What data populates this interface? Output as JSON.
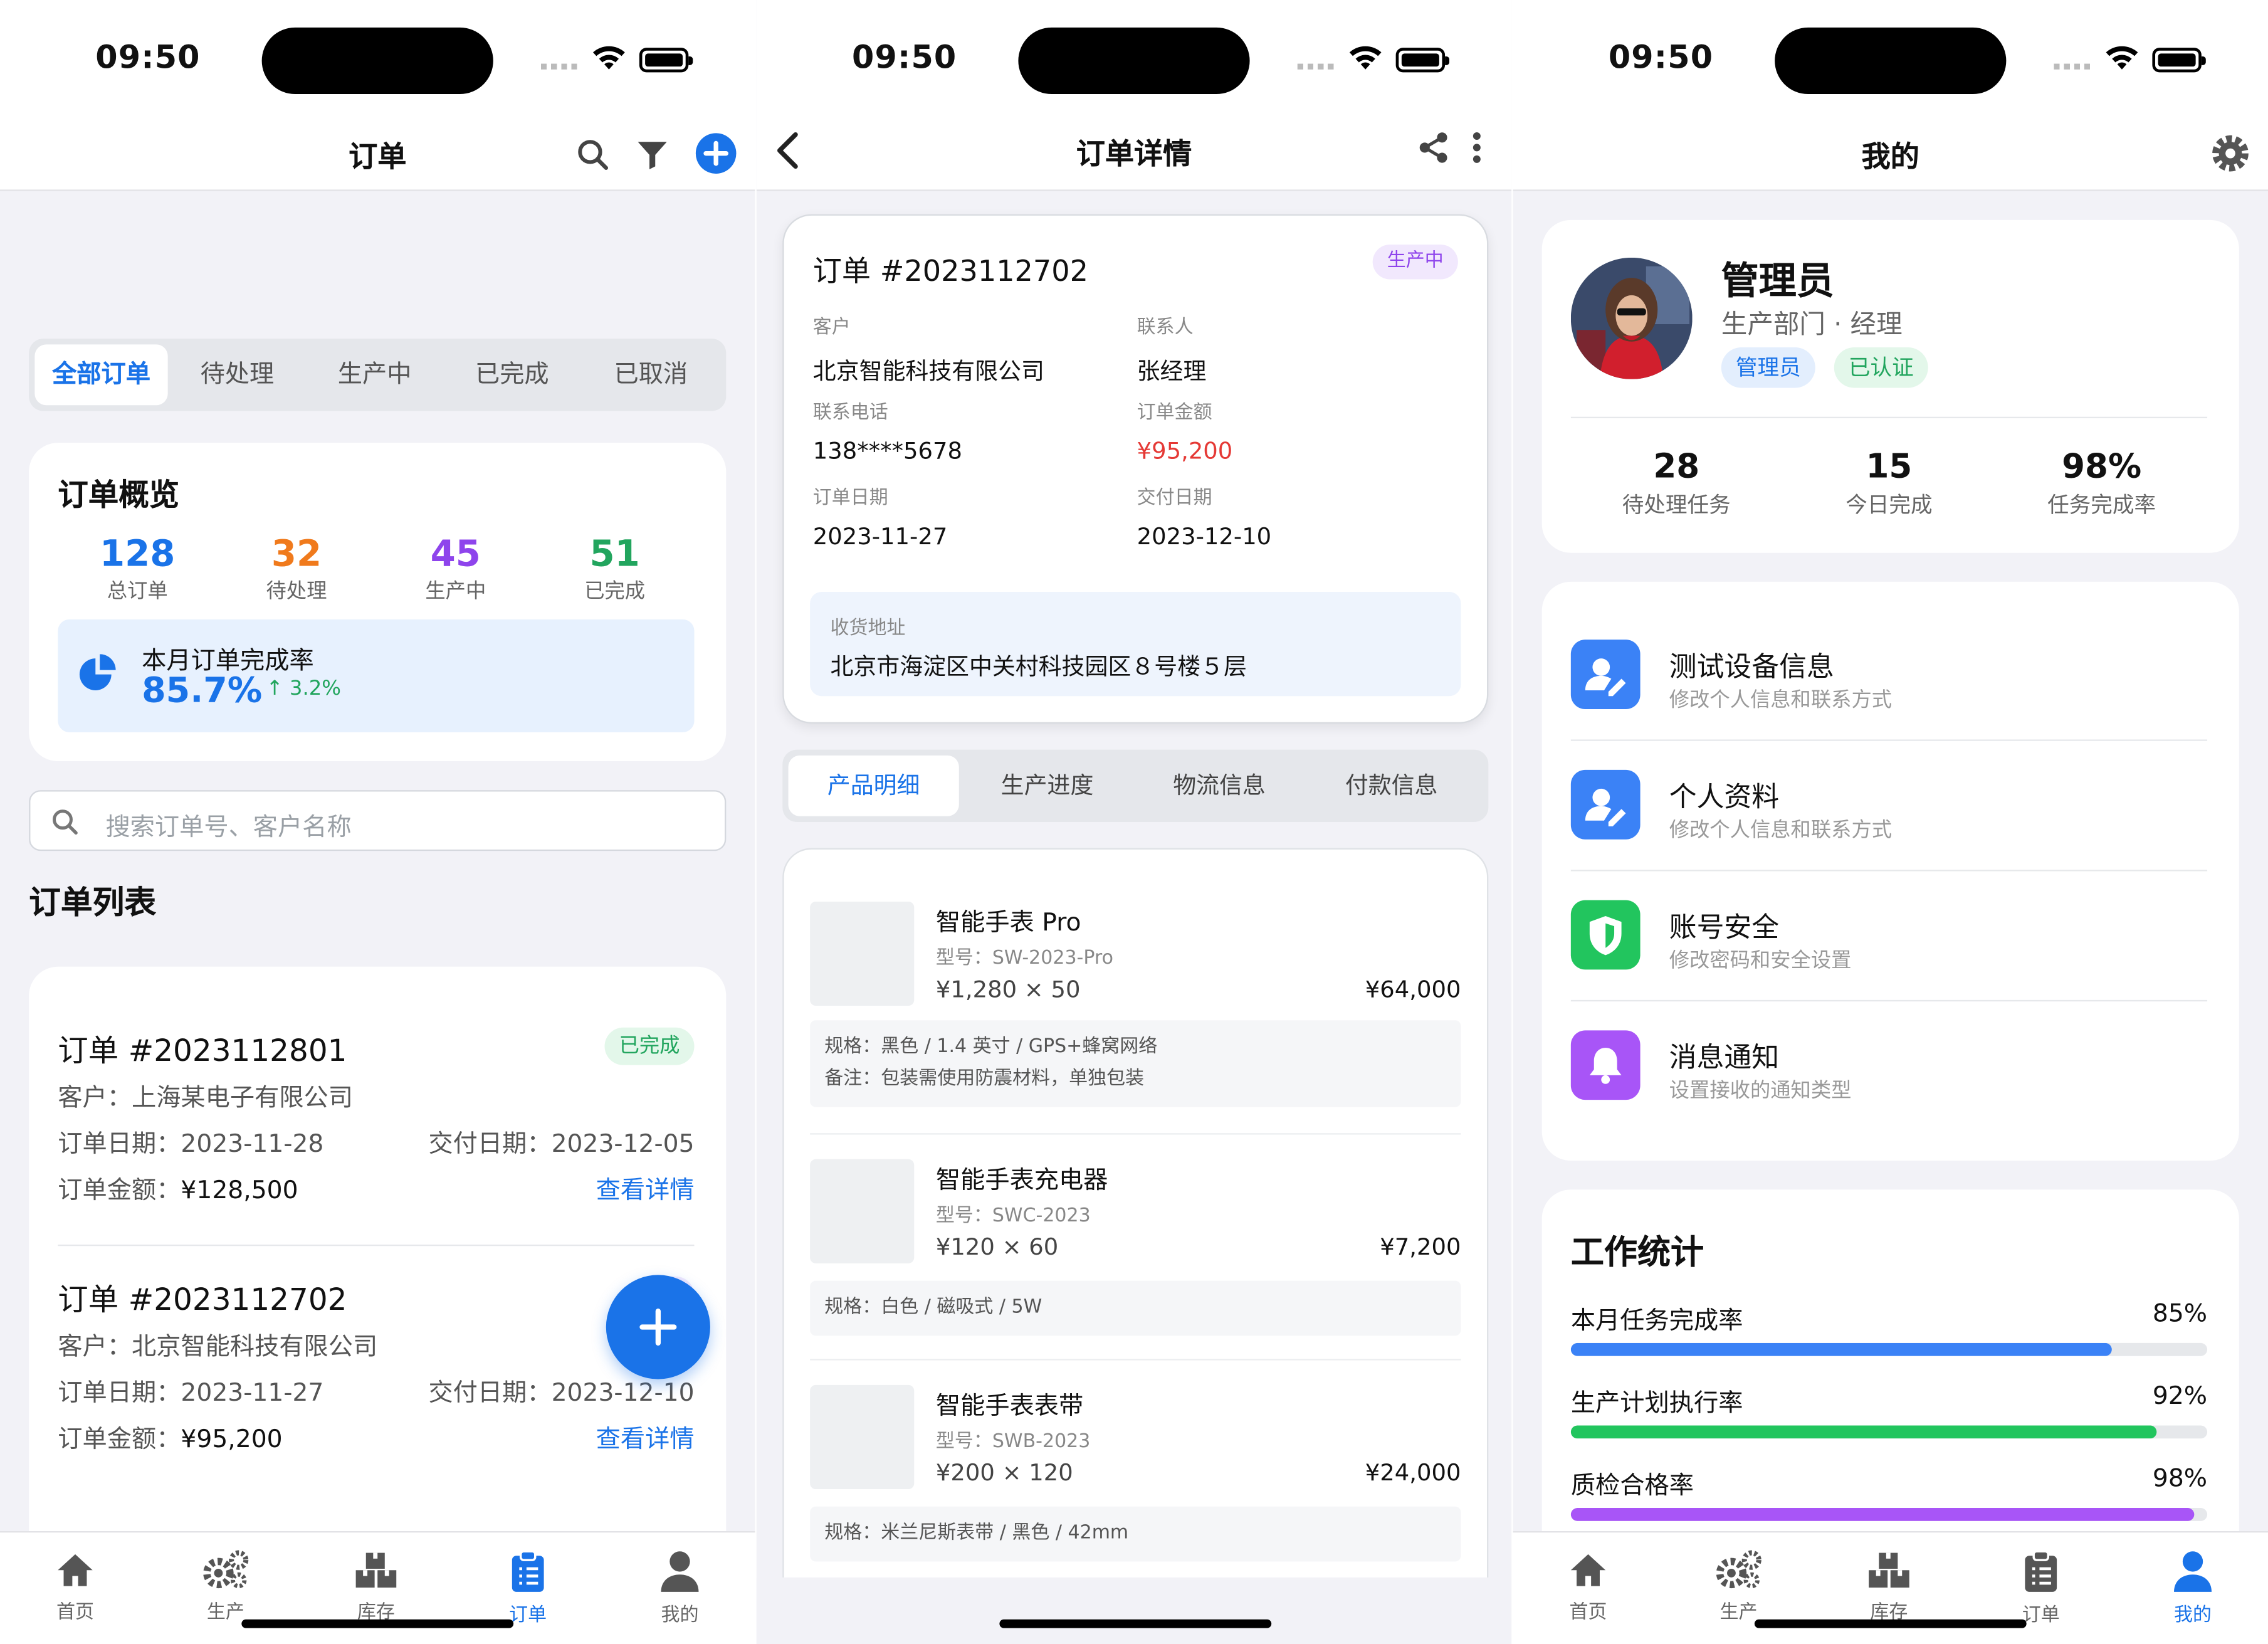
{
  "status": {
    "time": "09:50"
  },
  "screen1": {
    "title": "订单",
    "filters": [
      "全部订单",
      "待处理",
      "生产中",
      "已完成",
      "已取消"
    ],
    "overview": {
      "title": "订单概览",
      "stats": [
        {
          "value": "128",
          "label": "总订单",
          "color": "#1a73e8"
        },
        {
          "value": "32",
          "label": "待处理",
          "color": "#f07a1c"
        },
        {
          "value": "45",
          "label": "生产中",
          "color": "#8e44ec"
        },
        {
          "value": "51",
          "label": "已完成",
          "color": "#22a55e"
        }
      ],
      "rate_label": "本月订单完成率",
      "rate_value": "85.7%",
      "rate_delta": "3.2%"
    },
    "search_placeholder": "搜索订单号、客户名称",
    "list_title": "订单列表",
    "orders": [
      {
        "no": "订单 #2023112801",
        "status": "已完成",
        "customer": "客户：上海某电子有限公司",
        "order_date": "订单日期：2023-11-28",
        "delivery_date": "交付日期：2023-12-05",
        "amount_label": "订单金额：",
        "amount": "¥128,500",
        "link": "查看详情"
      },
      {
        "no": "订单 #2023112702",
        "status": "",
        "customer": "客户：北京智能科技有限公司",
        "order_date": "订单日期：2023-11-27",
        "delivery_date": "交付日期：2023-12-10",
        "amount_label": "订单金额：",
        "amount": "¥95,200",
        "link": "查看详情"
      }
    ]
  },
  "screen2": {
    "title": "订单详情",
    "order_no": "订单 #2023112702",
    "status": "生产中",
    "fields": [
      {
        "label": "客户",
        "value": "北京智能科技有限公司"
      },
      {
        "label": "联系人",
        "value": "张经理"
      },
      {
        "label": "联系电话",
        "value": "138****5678"
      },
      {
        "label": "订单金额",
        "value": "¥95,200"
      },
      {
        "label": "订单日期",
        "value": "2023-11-27"
      },
      {
        "label": "交付日期",
        "value": "2023-12-10"
      }
    ],
    "address_label": "收货地址",
    "address": "北京市海淀区中关村科技园区８号楼５层",
    "tabs": [
      "产品明细",
      "生产进度",
      "物流信息",
      "付款信息"
    ],
    "products": [
      {
        "name": "智能手表 Pro",
        "model": "型号：SW-2023-Pro",
        "qty": "¥1,280 × 50",
        "total": "¥64,000",
        "spec": "规格：黑色 / 1.4 英寸 / GPS+蜂窝网络",
        "note": "备注：包装需使用防震材料，单独包装"
      },
      {
        "name": "智能手表充电器",
        "model": "型号：SWC-2023",
        "qty": "¥120 × 60",
        "total": "¥7,200",
        "spec": "规格：白色 / 磁吸式 / 5W",
        "note": ""
      },
      {
        "name": "智能手表表带",
        "model": "型号：SWB-2023",
        "qty": "¥200 × 120",
        "total": "¥24,000",
        "spec": "规格：米兰尼斯表带 / 黑色 / 42mm",
        "note": ""
      }
    ]
  },
  "screen3": {
    "title": "我的",
    "name": "管理员",
    "dept": "生产部门 · 经理",
    "chips": [
      "管理员",
      "已认证"
    ],
    "stats": [
      {
        "value": "28",
        "label": "待处理任务"
      },
      {
        "value": "15",
        "label": "今日完成"
      },
      {
        "value": "98%",
        "label": "任务完成率"
      }
    ],
    "menu": [
      {
        "title": "测试设备信息",
        "sub": "修改个人信息和联系方式",
        "color": "#3b82f6",
        "icon": "user-edit-icon"
      },
      {
        "title": "个人资料",
        "sub": "修改个人信息和联系方式",
        "color": "#3b82f6",
        "icon": "user-edit-icon"
      },
      {
        "title": "账号安全",
        "sub": "修改密码和安全设置",
        "color": "#22c55e",
        "icon": "shield-icon"
      },
      {
        "title": "消息通知",
        "sub": "设置接收的通知类型",
        "color": "#a855f7",
        "icon": "bell-icon"
      }
    ],
    "work_title": "工作统计",
    "bars": [
      {
        "label": "本月任务完成率",
        "percent": "85%",
        "value": 0.85,
        "color": "#3b82f6"
      },
      {
        "label": "生产计划执行率",
        "percent": "92%",
        "value": 0.92,
        "color": "#22c55e"
      },
      {
        "label": "质检合格率",
        "percent": "98%",
        "value": 0.98,
        "color": "#a855f7"
      }
    ]
  },
  "tabbar": [
    "首页",
    "生产",
    "库存",
    "订单",
    "我的"
  ]
}
